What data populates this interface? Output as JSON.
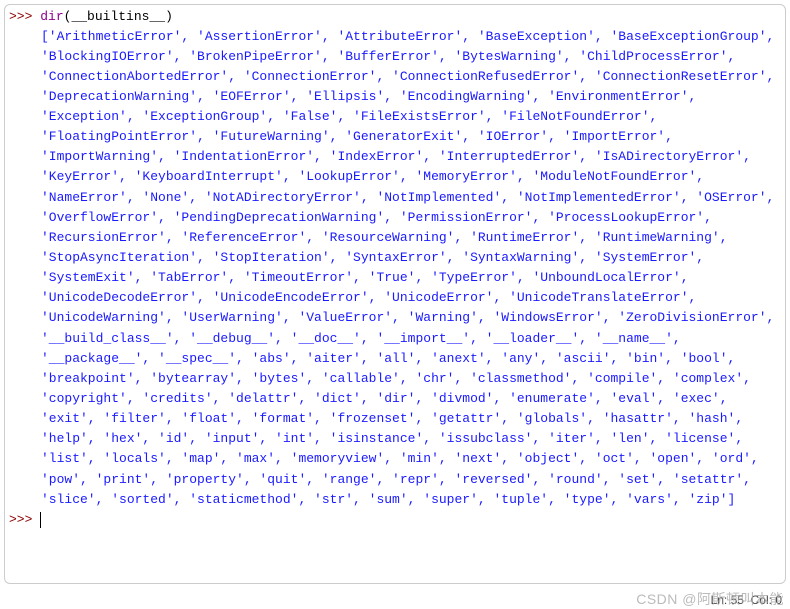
{
  "prompt": ">>> ",
  "input": {
    "call": "dir",
    "arg": "__builtins__"
  },
  "output_items": [
    "ArithmeticError",
    "AssertionError",
    "AttributeError",
    "BaseException",
    "BaseExceptionGroup",
    "BlockingIOError",
    "BrokenPipeError",
    "BufferError",
    "BytesWarning",
    "ChildProcessError",
    "ConnectionAbortedError",
    "ConnectionError",
    "ConnectionRefusedError",
    "ConnectionResetError",
    "DeprecationWarning",
    "EOFError",
    "Ellipsis",
    "EncodingWarning",
    "EnvironmentError",
    "Exception",
    "ExceptionGroup",
    "False",
    "FileExistsError",
    "FileNotFoundError",
    "FloatingPointError",
    "FutureWarning",
    "GeneratorExit",
    "IOError",
    "ImportError",
    "ImportWarning",
    "IndentationError",
    "IndexError",
    "InterruptedError",
    "IsADirectoryError",
    "KeyError",
    "KeyboardInterrupt",
    "LookupError",
    "MemoryError",
    "ModuleNotFoundError",
    "NameError",
    "None",
    "NotADirectoryError",
    "NotImplemented",
    "NotImplementedError",
    "OSError",
    "OverflowError",
    "PendingDeprecationWarning",
    "PermissionError",
    "ProcessLookupError",
    "RecursionError",
    "ReferenceError",
    "ResourceWarning",
    "RuntimeError",
    "RuntimeWarning",
    "StopAsyncIteration",
    "StopIteration",
    "SyntaxError",
    "SyntaxWarning",
    "SystemError",
    "SystemExit",
    "TabError",
    "TimeoutError",
    "True",
    "TypeError",
    "UnboundLocalError",
    "UnicodeDecodeError",
    "UnicodeEncodeError",
    "UnicodeError",
    "UnicodeTranslateError",
    "UnicodeWarning",
    "UserWarning",
    "ValueError",
    "Warning",
    "WindowsError",
    "ZeroDivisionError",
    "__build_class__",
    "__debug__",
    "__doc__",
    "__import__",
    "__loader__",
    "__name__",
    "__package__",
    "__spec__",
    "abs",
    "aiter",
    "all",
    "anext",
    "any",
    "ascii",
    "bin",
    "bool",
    "breakpoint",
    "bytearray",
    "bytes",
    "callable",
    "chr",
    "classmethod",
    "compile",
    "complex",
    "copyright",
    "credits",
    "delattr",
    "dict",
    "dir",
    "divmod",
    "enumerate",
    "eval",
    "exec",
    "exit",
    "filter",
    "float",
    "format",
    "frozenset",
    "getattr",
    "globals",
    "hasattr",
    "hash",
    "help",
    "hex",
    "id",
    "input",
    "int",
    "isinstance",
    "issubclass",
    "iter",
    "len",
    "license",
    "list",
    "locals",
    "map",
    "max",
    "memoryview",
    "min",
    "next",
    "object",
    "oct",
    "open",
    "ord",
    "pow",
    "print",
    "property",
    "quit",
    "range",
    "repr",
    "reversed",
    "round",
    "set",
    "setattr",
    "slice",
    "sorted",
    "staticmethod",
    "str",
    "sum",
    "super",
    "tuple",
    "type",
    "vars",
    "zip"
  ],
  "status": {
    "ln_label": "Ln:",
    "ln": 55,
    "col_label": "Col:",
    "col": 0
  },
  "watermark": "CSDN @阿斯顿叫本能"
}
